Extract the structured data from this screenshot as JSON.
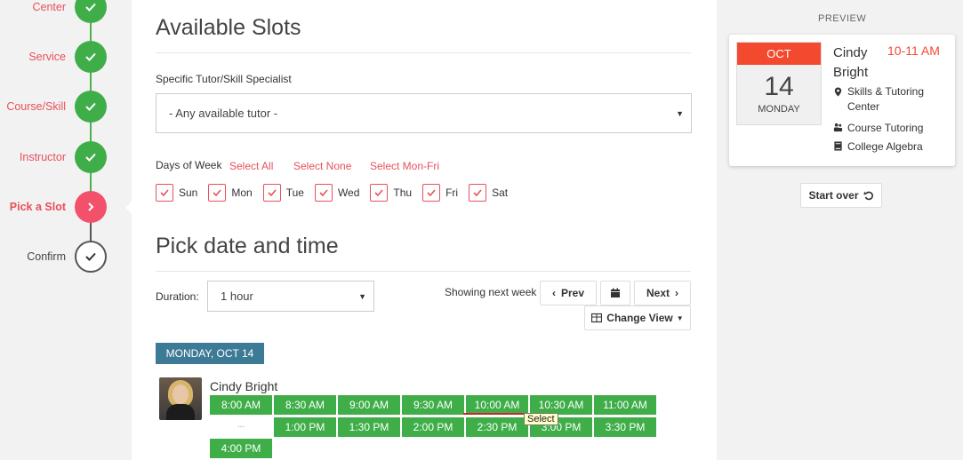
{
  "stepper": {
    "steps": [
      {
        "label": "Center",
        "state": "done"
      },
      {
        "label": "Service",
        "state": "done"
      },
      {
        "label": "Course/Skill",
        "state": "done"
      },
      {
        "label": "Instructor",
        "state": "done"
      },
      {
        "label": "Pick a Slot",
        "state": "current"
      },
      {
        "label": "Confirm",
        "state": "todo"
      }
    ]
  },
  "slots_section": {
    "title": "Available Slots",
    "tutor_label": "Specific Tutor/Skill Specialist",
    "tutor_value": "- Any available tutor -",
    "days_label": "Days of Week",
    "select_all": "Select All",
    "select_none": "Select None",
    "select_mon_fri": "Select Mon-Fri",
    "days": [
      "Sun",
      "Mon",
      "Tue",
      "Wed",
      "Thu",
      "Fri",
      "Sat"
    ]
  },
  "pick_section": {
    "title": "Pick date and time",
    "duration_label": "Duration:",
    "duration_value": "1 hour",
    "showing_text": "Showing next week",
    "prev_label": "Prev",
    "next_label": "Next",
    "change_view_label": "Change View",
    "date_banner": "MONDAY, OCT 14",
    "tutor_name": "Cindy Bright",
    "ellipsis": "...",
    "tooltip": "Select",
    "slots_row1": [
      "8:00 AM",
      "8:30 AM",
      "9:00 AM",
      "9:30 AM",
      "10:00 AM",
      "10:30 AM",
      "11:00 AM"
    ],
    "slots_row2": [
      "1:00 PM",
      "1:30 PM",
      "2:00 PM",
      "2:30 PM",
      "3:00 PM",
      "3:30 PM"
    ],
    "slots_row3": [
      "4:00 PM"
    ]
  },
  "preview": {
    "title": "PREVIEW",
    "month": "OCT",
    "day": "14",
    "dow": "MONDAY",
    "name": "Cindy Bright",
    "time": "10-11 AM",
    "location": "Skills & Tutoring Center",
    "service": "Course Tutoring",
    "course": "College Algebra",
    "start_over": "Start over"
  },
  "colors": {
    "accent_red": "#e8505b",
    "done_green": "#3fae49",
    "banner_blue": "#3d7a96",
    "calendar_red": "#f34a2f"
  }
}
